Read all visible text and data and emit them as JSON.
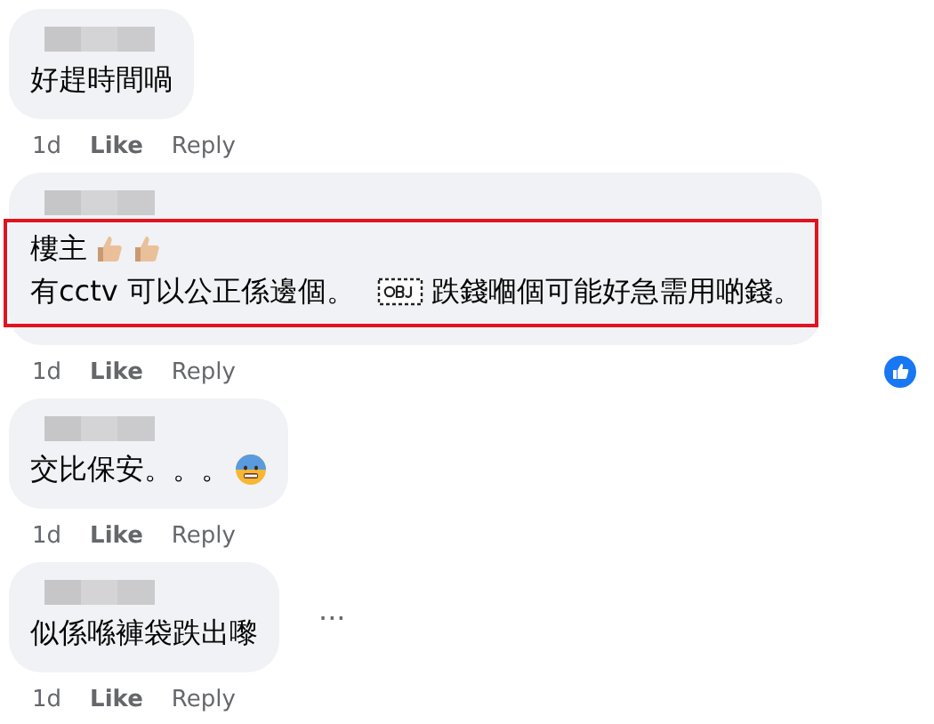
{
  "comments": [
    {
      "lines": [
        [
          {
            "kind": "text",
            "text": "好趕時間喎"
          }
        ]
      ],
      "highlighted": false,
      "reaction": false,
      "time": "1d",
      "like": "Like",
      "reply": "Reply"
    },
    {
      "lines": [
        [
          {
            "kind": "text",
            "text": "樓主"
          },
          {
            "kind": "thumb"
          },
          {
            "kind": "thumb"
          }
        ],
        [
          {
            "kind": "text",
            "text": "有cctv 可以公正係邊個。"
          },
          {
            "kind": "obj"
          },
          {
            "kind": "text",
            "text": "跌錢嗰個可能好急需用啲錢。"
          }
        ]
      ],
      "highlighted": true,
      "reaction": true,
      "time": "1d",
      "like": "Like",
      "reply": "Reply"
    },
    {
      "lines": [
        [
          {
            "kind": "text",
            "text": "交比保安。。。"
          },
          {
            "kind": "face"
          }
        ]
      ],
      "highlighted": false,
      "reaction": false,
      "time": "1d",
      "like": "Like",
      "reply": "Reply"
    },
    {
      "lines": [
        [
          {
            "kind": "text",
            "text": "似係喺褲袋跌出嚟"
          }
        ]
      ],
      "highlighted": false,
      "reaction": false,
      "more": "···",
      "time": "1d",
      "like": "Like",
      "reply": "Reply"
    }
  ]
}
